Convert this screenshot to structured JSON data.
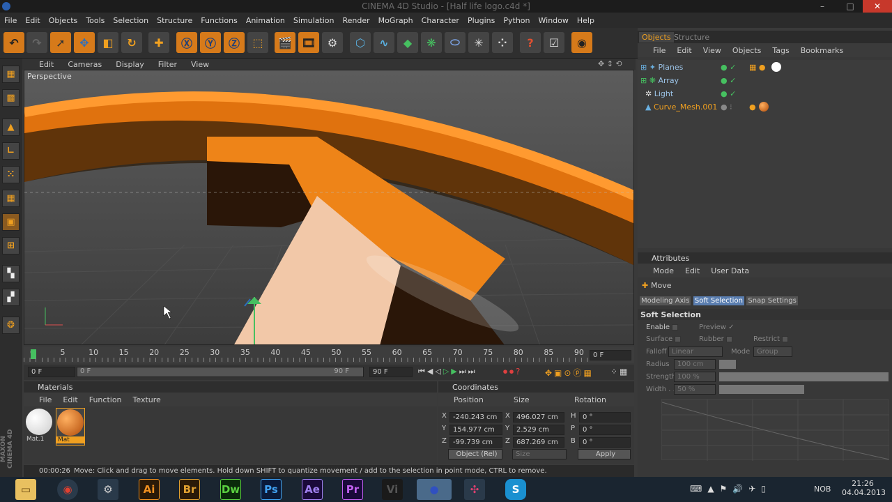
{
  "window": {
    "title": "CINEMA 4D Studio - [Half life logo.c4d *]",
    "min": "–",
    "max": "□",
    "close": "✕"
  },
  "menu": [
    "File",
    "Edit",
    "Objects",
    "Tools",
    "Selection",
    "Structure",
    "Functions",
    "Animation",
    "Simulation",
    "Render",
    "MoGraph",
    "Character",
    "Plugins",
    "Python",
    "Window",
    "Help"
  ],
  "viewport": {
    "menu": [
      "Edit",
      "Cameras",
      "Display",
      "Filter",
      "View"
    ],
    "label": "Perspective"
  },
  "timeline": {
    "ticks": [
      "0",
      "5",
      "10",
      "15",
      "20",
      "25",
      "30",
      "35",
      "40",
      "45",
      "50",
      "55",
      "60",
      "65",
      "70",
      "75",
      "80",
      "85",
      "90"
    ],
    "current_frame": "0 F"
  },
  "playback": {
    "start": "0 F",
    "slider_start": "0 F",
    "slider_end": "90 F",
    "end": "90 F"
  },
  "materials": {
    "title": "Materials",
    "menu": [
      "File",
      "Edit",
      "Function",
      "Texture"
    ],
    "items": [
      {
        "name": "Mat.1",
        "color": "#f4f4f4"
      },
      {
        "name": "Mat",
        "color": "#d86a18"
      }
    ]
  },
  "coordinates": {
    "title": "Coordinates",
    "headers": [
      "Position",
      "Size",
      "Rotation"
    ],
    "rows": [
      {
        "axis": "X",
        "pos": "-240.243 cm",
        "saxis": "X",
        "size": "496.027 cm",
        "raxis": "H",
        "rot": "0 °"
      },
      {
        "axis": "Y",
        "pos": "154.977 cm",
        "saxis": "Y",
        "size": "2.529 cm",
        "raxis": "P",
        "rot": "0 °"
      },
      {
        "axis": "Z",
        "pos": "-99.739 cm",
        "saxis": "Z",
        "size": "687.269 cm",
        "raxis": "B",
        "rot": "0 °"
      }
    ],
    "mode_select": "Object (Rel)",
    "size_select": "Size",
    "apply": "Apply"
  },
  "objects": {
    "tabs": [
      "Objects",
      "Structure"
    ],
    "menu": [
      "File",
      "Edit",
      "View",
      "Objects",
      "Tags",
      "Bookmarks"
    ],
    "items": [
      "Planes",
      "Array",
      "Light",
      "Curve_Mesh.001"
    ]
  },
  "attributes": {
    "title": "Attributes",
    "menu": [
      "Mode",
      "Edit",
      "User Data"
    ],
    "tool": "Move",
    "tabs": [
      "Modeling Axis",
      "Soft Selection",
      "Snap Settings"
    ],
    "section": "Soft Selection",
    "enable": "Enable",
    "preview": "Preview",
    "surface": "Surface",
    "rubber": "Rubber",
    "restrict": "Restrict",
    "falloff": "Falloff",
    "falloff_val": "Linear",
    "mode": "Mode",
    "mode_val": "Group",
    "radius": "Radius",
    "radius_val": "100 cm",
    "strength": "Strength",
    "strength_val": "100 %",
    "width": "Width . .",
    "width_val": "50 %"
  },
  "status": {
    "time": "00:00:26",
    "message": "Move: Click and drag to move elements. Hold down SHIFT to quantize movement / add to the selection in point mode, CTRL to remove."
  },
  "maxon": "MAXON\nCINEMA 4D",
  "taskbar": {
    "apps": [
      "Ai",
      "Br",
      "Dw",
      "Ps",
      "Ae",
      "Pr"
    ],
    "lang": "NOB",
    "time": "21:26",
    "date": "04.04.2013"
  }
}
